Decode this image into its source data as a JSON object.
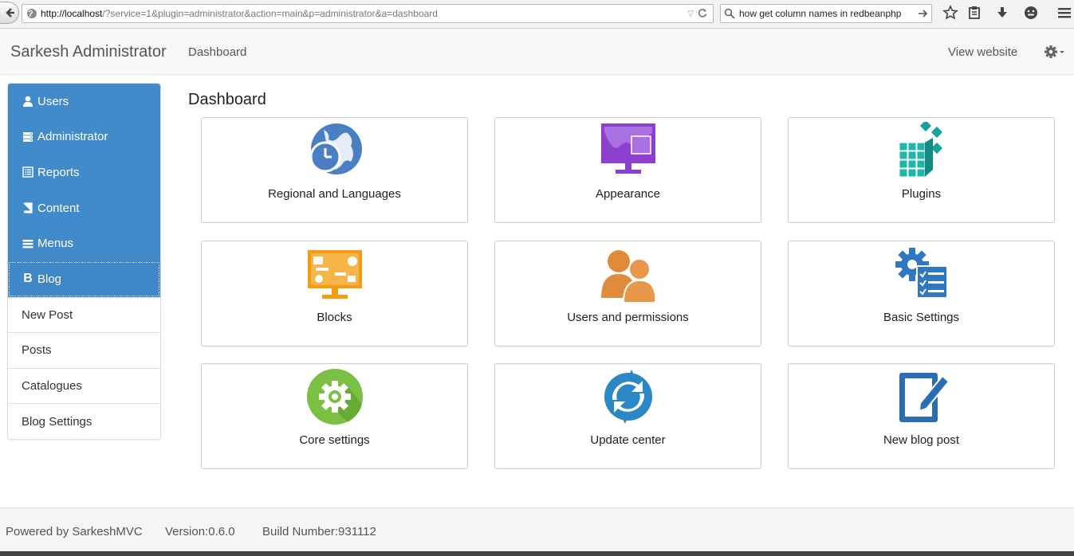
{
  "browser": {
    "url_host": "http://localhost",
    "url_path": "/?service=1&plugin=administrator&action=main&p=administrator&a=dashboard",
    "search_query": "how get column names in redbeanphp"
  },
  "navbar": {
    "brand": "Sarkesh Administrator",
    "dashboard_link": "Dashboard",
    "view_website_link": "View website"
  },
  "sidebar": {
    "items": [
      {
        "label": "Users",
        "icon": "user-icon"
      },
      {
        "label": "Administrator",
        "icon": "server-icon"
      },
      {
        "label": "Reports",
        "icon": "list-alt-icon"
      },
      {
        "label": "Content",
        "icon": "book-icon"
      },
      {
        "label": "Menus",
        "icon": "menu-icon"
      },
      {
        "label": "Blog",
        "icon": "bold-b-icon"
      },
      {
        "label": "New Post"
      },
      {
        "label": "Posts"
      },
      {
        "label": "Catalogues"
      },
      {
        "label": "Blog Settings"
      }
    ]
  },
  "main": {
    "title": "Dashboard",
    "tiles": [
      {
        "label": "Regional and Languages",
        "icon": "globe-clock-icon"
      },
      {
        "label": "Appearance",
        "icon": "monitor-chart-icon"
      },
      {
        "label": "Plugins",
        "icon": "cubes-icon"
      },
      {
        "label": "Blocks",
        "icon": "monitor-blocks-icon"
      },
      {
        "label": "Users and permissions",
        "icon": "users-icon"
      },
      {
        "label": "Basic Settings",
        "icon": "gear-checklist-icon"
      },
      {
        "label": "Core settings",
        "icon": "gear-circle-icon"
      },
      {
        "label": "Update center",
        "icon": "refresh-icon"
      },
      {
        "label": "New blog post",
        "icon": "edit-pencil-icon"
      }
    ]
  },
  "footer": {
    "powered": "Powered by SarkeshMVC",
    "version": "Version:0.6.0",
    "build": "Build Number:931112"
  },
  "colors": {
    "sidebar_blue": "#428bca",
    "globe_blue": "#4a7fc6",
    "appearance_purple": "#8e3fd0",
    "plugins_teal": "#16a39a",
    "blocks_orange": "#f39c12",
    "users_orange": "#e08a3c",
    "settings_blue": "#2f78c1",
    "core_green": "#7bc043",
    "update_blue": "#2b88c4",
    "blog_blue": "#2a6db5"
  }
}
